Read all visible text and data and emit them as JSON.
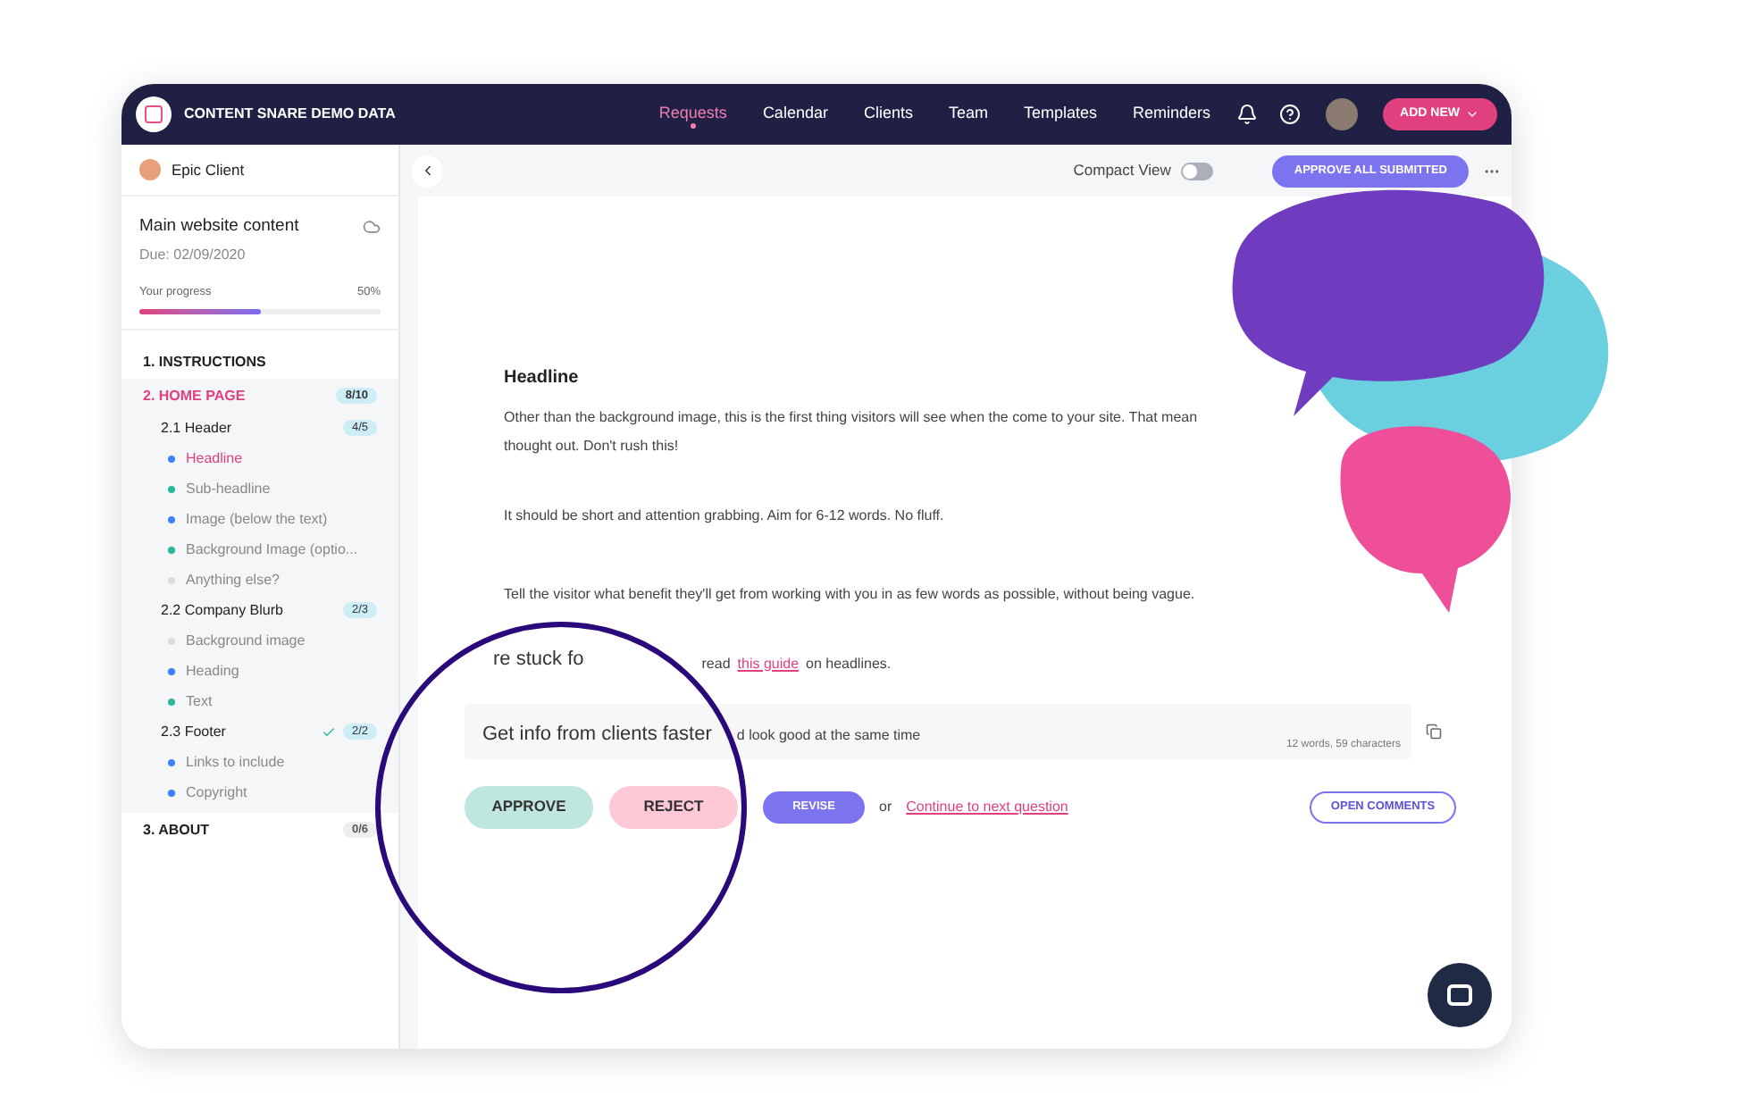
{
  "topbar": {
    "brand": "CONTENT SNARE DEMO DATA",
    "nav": [
      {
        "label": "Requests",
        "selected": true
      },
      {
        "label": "Calendar",
        "selected": false
      },
      {
        "label": "Clients",
        "selected": false
      },
      {
        "label": "Team",
        "selected": false
      },
      {
        "label": "Templates",
        "selected": false
      },
      {
        "label": "Reminders",
        "selected": false
      }
    ],
    "add_button": "ADD NEW"
  },
  "toolbar": {
    "compact_view": {
      "label": "Compact View",
      "on": false
    },
    "approve_all": "APPROVE ALL SUBMITTED"
  },
  "sidebar": {
    "client": "Epic Client",
    "request": {
      "title": "Main website content",
      "due": "Due: 02/09/2020",
      "progress_label": "Your progress",
      "progress_value": "50%",
      "level": 0.5
    },
    "sections": [
      {
        "label": "1. INSTRUCTIONS",
        "selected": false
      },
      {
        "label": "2. HOME PAGE",
        "selected": true,
        "count": "8/10",
        "children": [
          {
            "label": "2.1 Header",
            "count": "4/5",
            "done": false,
            "children": [
              {
                "label": "Headline",
                "color": "#3b82f6",
                "selected": true
              },
              {
                "label": "Sub-headline",
                "color": "#2bb59a",
                "selected": false
              },
              {
                "label": "Image (below the text)",
                "color": "#3b82f6",
                "selected": false
              },
              {
                "label": "Background Image (optio...",
                "color": "#2bb59a",
                "selected": false
              },
              {
                "label": "Anything else?",
                "color": "#dddddd",
                "selected": false
              }
            ]
          },
          {
            "label": "2.2 Company Blurb",
            "count": "2/3",
            "done": false,
            "children": [
              {
                "label": "Background image",
                "color": "#dddddd",
                "selected": false
              },
              {
                "label": "Heading",
                "color": "#3b82f6",
                "selected": false
              },
              {
                "label": "Text",
                "color": "#2bb59a",
                "selected": false
              }
            ]
          },
          {
            "label": "2.3 Footer",
            "count": "2/2",
            "done": true,
            "children": [
              {
                "label": "Links to include",
                "color": "#3b82f6",
                "selected": false
              },
              {
                "label": "Copyright",
                "color": "#3b82f6",
                "selected": false
              }
            ]
          }
        ]
      },
      {
        "label": "3. ABOUT",
        "selected": false,
        "count": "0/6"
      }
    ]
  },
  "question": {
    "title": "Headline",
    "paragraphs": [
      "Other than the background image, this is the first thing visitors will see when the come to your site. That mean",
      "thought out. Don't rush this!",
      "It should be short and attention grabbing. Aim for 6-12 words. No fluff.",
      "Tell the visitor what benefit they'll get from working with you in as few words as possible, without being vague."
    ],
    "tip": {
      "magnified": "re stuck fo",
      "before": "read",
      "link": "this guide",
      "after": "on headlines."
    },
    "answer": {
      "magnified": "Get info from clients faster",
      "value": "d look good at the same time",
      "count": "12 words, 59 characters"
    },
    "actions": {
      "approve": "APPROVE",
      "reject": "REJECT",
      "revise": "REVISE",
      "or": "or",
      "next": "Continue to next question",
      "comments": "OPEN COMMENTS"
    }
  }
}
